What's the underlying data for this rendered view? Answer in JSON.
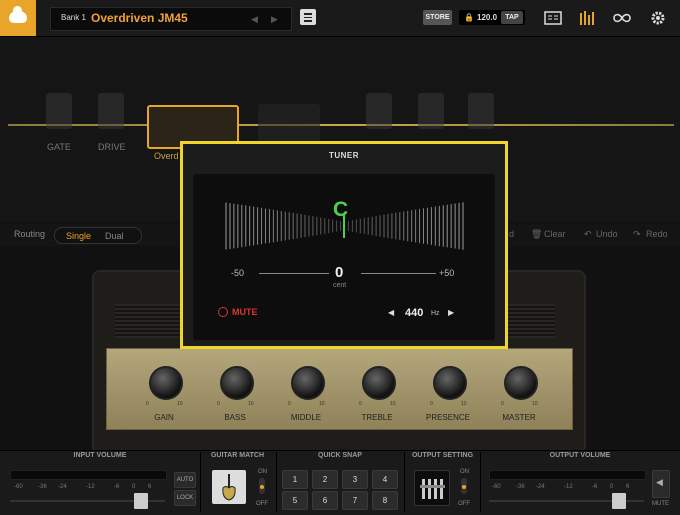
{
  "header": {
    "bank": "Bank 1",
    "preset_name": "Overdriven JM45",
    "store": "STORE",
    "bpm": "120.0",
    "tap": "TAP"
  },
  "chain": {
    "pedals": [
      {
        "label": "GATE"
      },
      {
        "label": "DRIVE"
      }
    ],
    "amp_label": "Overd"
  },
  "routing": {
    "label": "Routing",
    "single": "Single",
    "dual": "Dual",
    "clear": "Clear",
    "undo": "Undo",
    "redo": "Redo",
    "partial": "d"
  },
  "amp": {
    "knobs": [
      "GAIN",
      "BASS",
      "MIDDLE",
      "TREBLE",
      "PRESENCE",
      "MASTER"
    ],
    "min": "0",
    "max": "10"
  },
  "tuner": {
    "title": "TUNER",
    "note": "C",
    "scale_min": "-50",
    "scale_max": "+50",
    "cents": "0",
    "cents_unit": "cent",
    "mute": "MUTE",
    "ref_hz": "440",
    "hz_unit": "Hz"
  },
  "bottom": {
    "input_volume": "INPUT VOLUME",
    "guitar_match": "GUITAR MATCH",
    "quick_snap": "QUICK SNAP",
    "output_setting": "OUTPUT SETTING",
    "output_volume": "OUTPUT VOLUME",
    "auto": "AUTO",
    "lock": "LOCK",
    "on": "ON",
    "off": "OFF",
    "mute": "MUTE",
    "scale": [
      "-60",
      "-36",
      "-24",
      "-12",
      "-6",
      "0",
      "6"
    ],
    "snaps": [
      "1",
      "2",
      "3",
      "4",
      "5",
      "6",
      "7",
      "8"
    ]
  },
  "colors": {
    "accent": "#e9a42a",
    "tuner_border": "#f0d52a",
    "in_tune": "#4cd04c",
    "mute": "#dd3333"
  }
}
